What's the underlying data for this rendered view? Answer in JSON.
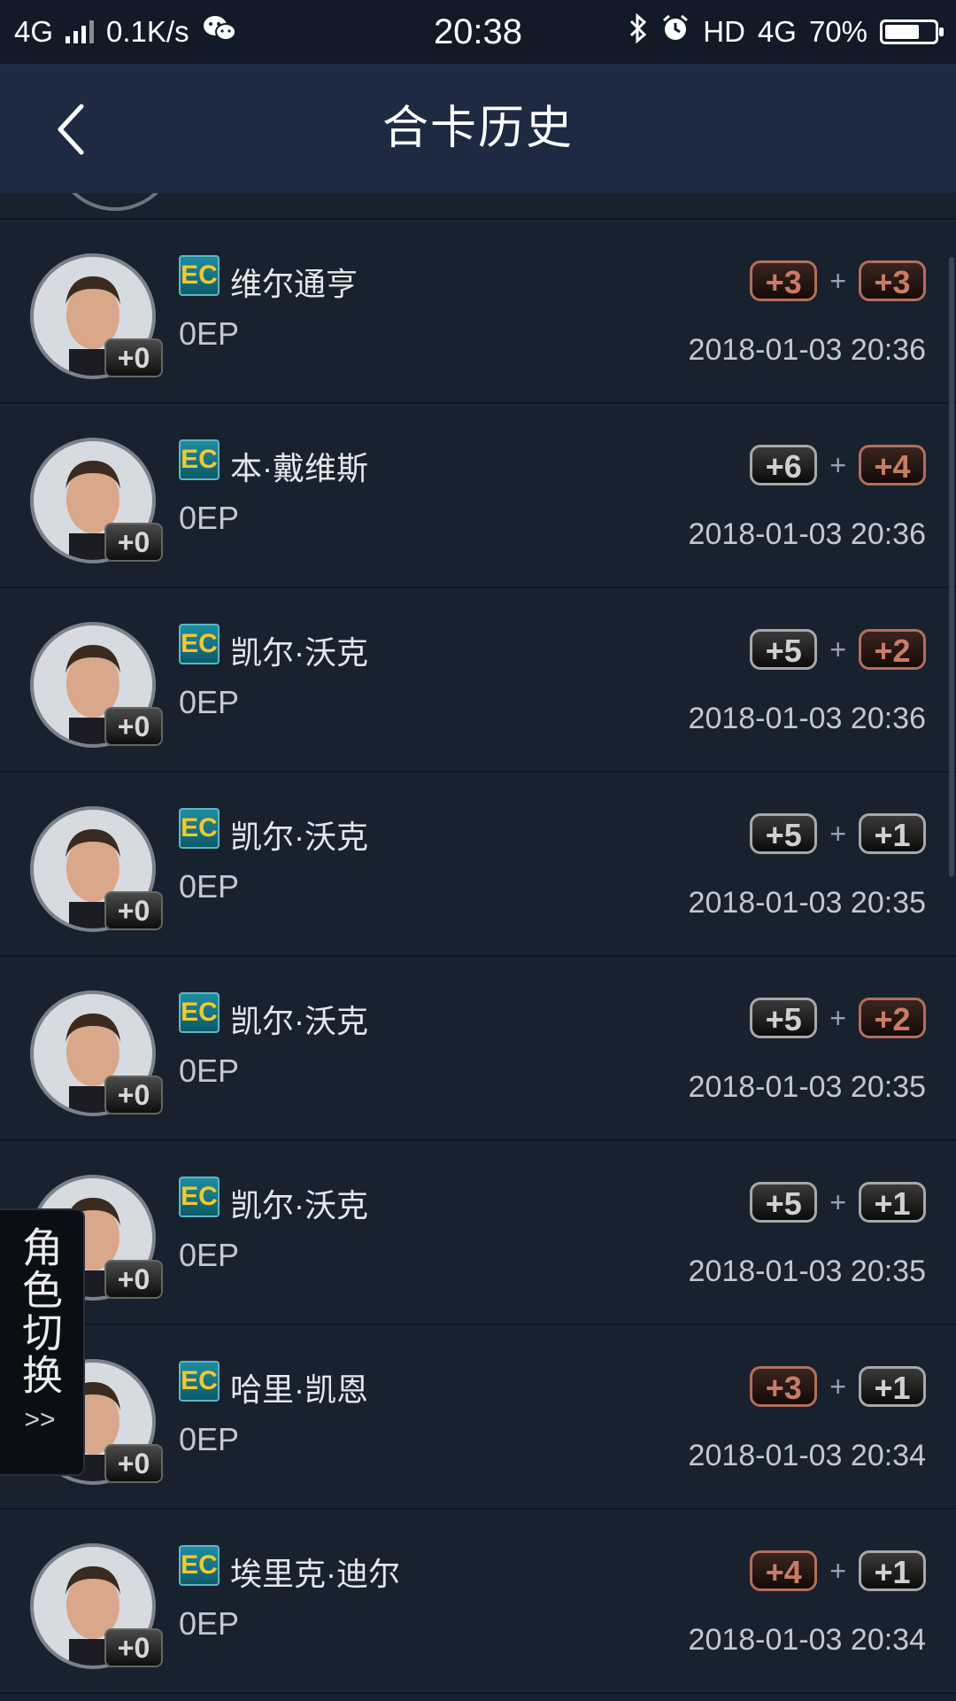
{
  "status_bar": {
    "network": "4G",
    "speed": "0.1K/s",
    "time": "20:38",
    "hd": "HD",
    "network_right": "4G",
    "battery": "70%",
    "battery_level": 0.7
  },
  "header": {
    "title": "合卡历史"
  },
  "rows": [
    {
      "name": "维尔通亨",
      "ep": "0EP",
      "level": "+0",
      "badge_a": "+3",
      "badge_a_tier": "copper",
      "badge_b": "+3",
      "badge_b_tier": "copper",
      "plus": "+",
      "date": "2018-01-03 20:36",
      "ec": "EC"
    },
    {
      "name": "本·戴维斯",
      "ep": "0EP",
      "level": "+0",
      "badge_a": "+6",
      "badge_a_tier": "silver",
      "badge_b": "+4",
      "badge_b_tier": "copper",
      "plus": "+",
      "date": "2018-01-03 20:36",
      "ec": "EC"
    },
    {
      "name": "凯尔·沃克",
      "ep": "0EP",
      "level": "+0",
      "badge_a": "+5",
      "badge_a_tier": "silver",
      "badge_b": "+2",
      "badge_b_tier": "copper",
      "plus": "+",
      "date": "2018-01-03 20:36",
      "ec": "EC"
    },
    {
      "name": "凯尔·沃克",
      "ep": "0EP",
      "level": "+0",
      "badge_a": "+5",
      "badge_a_tier": "silver",
      "badge_b": "+1",
      "badge_b_tier": "silver",
      "plus": "+",
      "date": "2018-01-03 20:35",
      "ec": "EC"
    },
    {
      "name": "凯尔·沃克",
      "ep": "0EP",
      "level": "+0",
      "badge_a": "+5",
      "badge_a_tier": "silver",
      "badge_b": "+2",
      "badge_b_tier": "copper",
      "plus": "+",
      "date": "2018-01-03 20:35",
      "ec": "EC"
    },
    {
      "name": "凯尔·沃克",
      "ep": "0EP",
      "level": "+0",
      "badge_a": "+5",
      "badge_a_tier": "silver",
      "badge_b": "+1",
      "badge_b_tier": "silver",
      "plus": "+",
      "date": "2018-01-03 20:35",
      "ec": "EC"
    },
    {
      "name": "哈里·凯恩",
      "ep": "0EP",
      "level": "+0",
      "badge_a": "+3",
      "badge_a_tier": "copper",
      "badge_b": "+1",
      "badge_b_tier": "silver",
      "plus": "+",
      "date": "2018-01-03 20:34",
      "ec": "EC"
    },
    {
      "name": "埃里克·迪尔",
      "ep": "0EP",
      "level": "+0",
      "badge_a": "+4",
      "badge_a_tier": "copper",
      "badge_b": "+1",
      "badge_b_tier": "silver",
      "plus": "+",
      "date": "2018-01-03 20:34",
      "ec": "EC"
    }
  ],
  "side_tab": {
    "label": "角色切换",
    "chevron": ">>"
  },
  "colors": {
    "background": "#18212e",
    "header": "#1e2a42",
    "copper": "#c97c63",
    "silver": "#d0d0d0"
  }
}
